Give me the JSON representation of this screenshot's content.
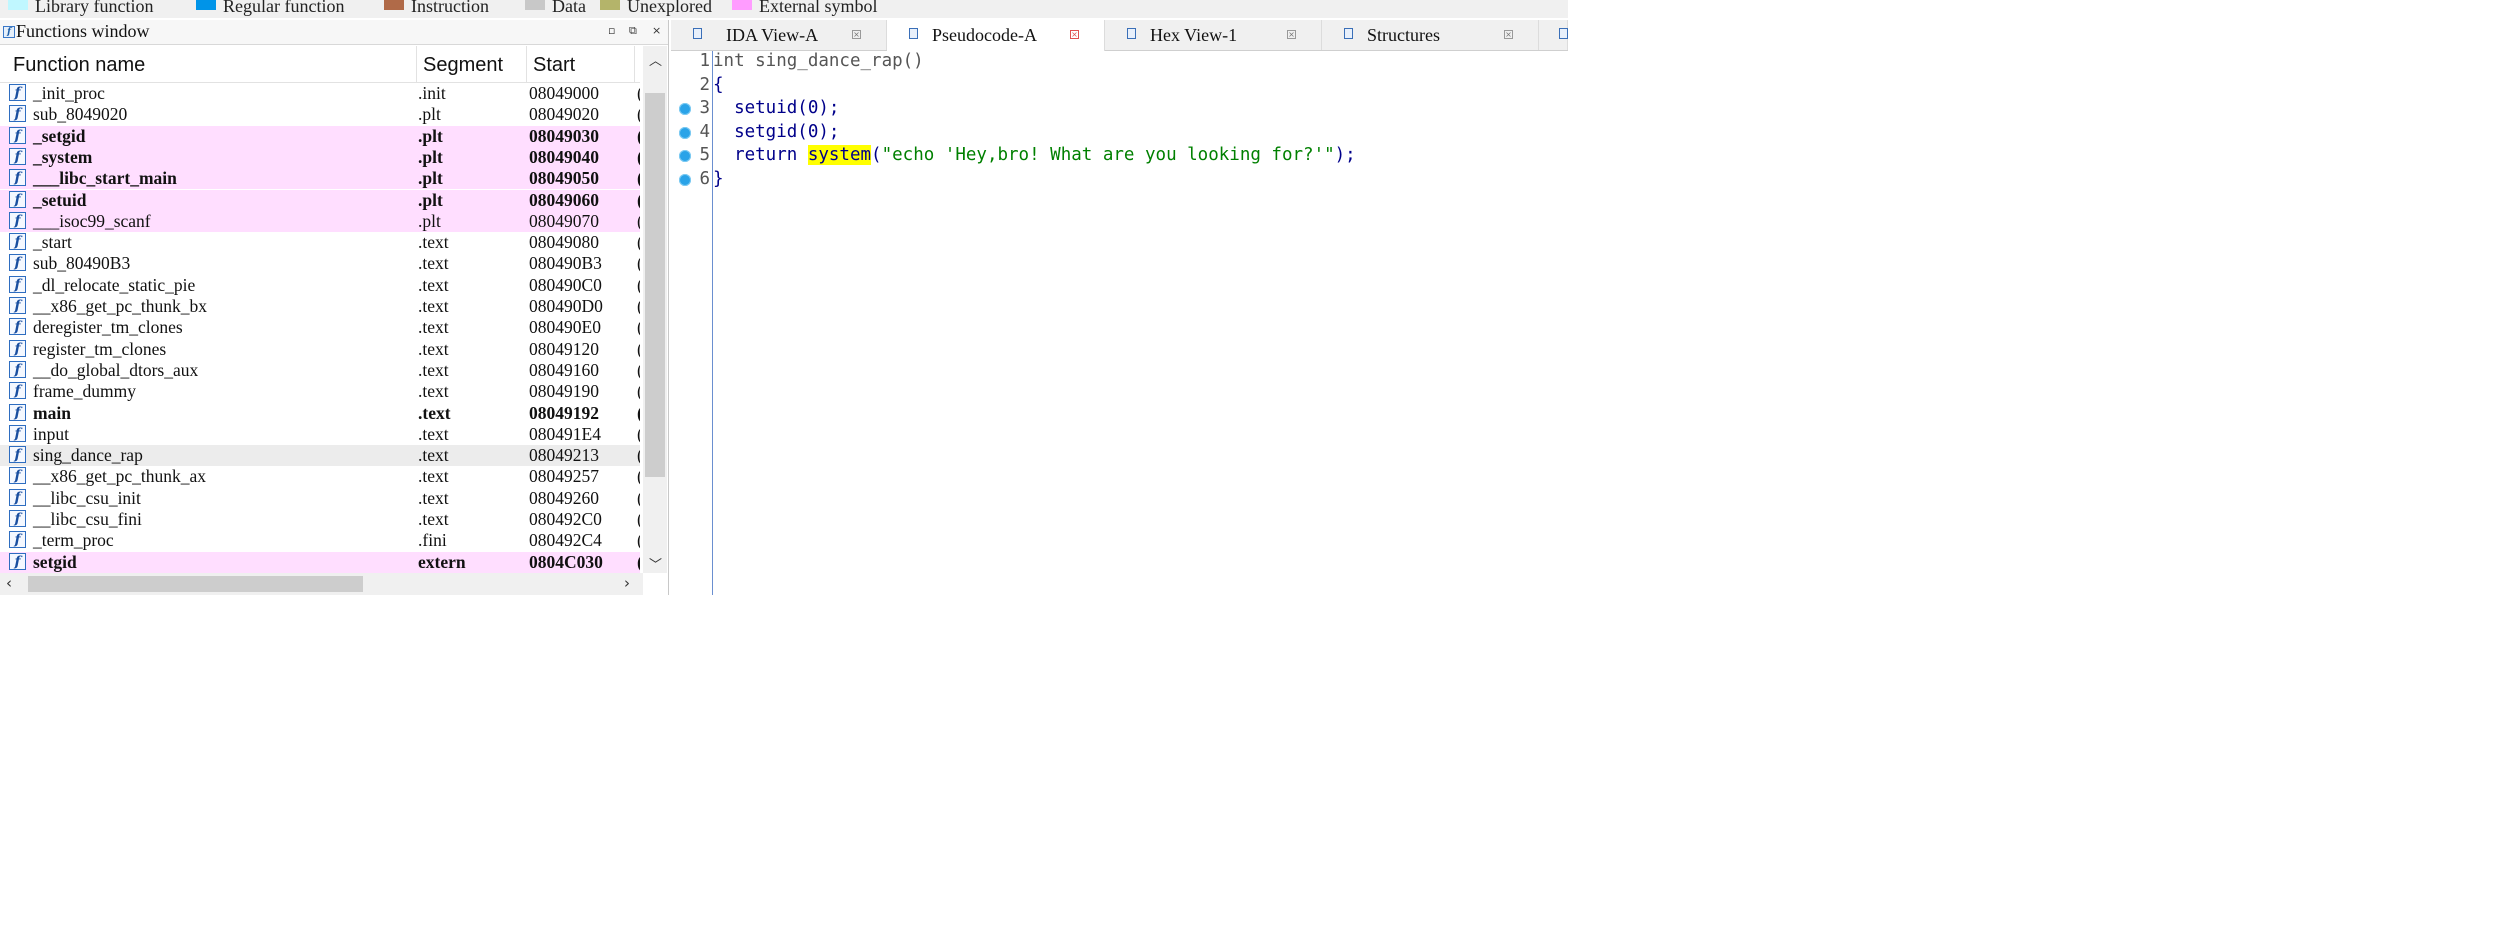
{
  "legend": {
    "items": [
      {
        "label": "Library function",
        "color": "#c0f7ff"
      },
      {
        "label": "Regular function",
        "color": "#0094e8"
      },
      {
        "label": "Instruction",
        "color": "#b06a48"
      },
      {
        "label": "Data",
        "color": "#c8c8c8"
      },
      {
        "label": "Unexplored",
        "color": "#b4b46a"
      },
      {
        "label": "External symbol",
        "color": "#ff9cff"
      }
    ]
  },
  "functions_window": {
    "title": "Functions window",
    "buttons": {
      "minimize": "▫",
      "float": "⧉",
      "close": "×"
    },
    "columns": {
      "name": "Function name",
      "segment": "Segment",
      "start": "Start",
      "length": "("
    },
    "rows": [
      {
        "name": "_init_proc",
        "segment": ".init",
        "start": "08049000",
        "length": "(",
        "kind": "normal"
      },
      {
        "name": "sub_8049020",
        "segment": ".plt",
        "start": "08049020",
        "length": "(",
        "kind": "normal"
      },
      {
        "name": "_setgid",
        "segment": ".plt",
        "start": "08049030",
        "length": "(",
        "kind": "ext-bold"
      },
      {
        "name": "_system",
        "segment": ".plt",
        "start": "08049040",
        "length": "(",
        "kind": "ext-bold"
      },
      {
        "name": "___libc_start_main",
        "segment": ".plt",
        "start": "08049050",
        "length": "(",
        "kind": "ext-bold"
      },
      {
        "name": "_setuid",
        "segment": ".plt",
        "start": "08049060",
        "length": "(",
        "kind": "ext-bold"
      },
      {
        "name": "___isoc99_scanf",
        "segment": ".plt",
        "start": "08049070",
        "length": "(",
        "kind": "ext"
      },
      {
        "name": "_start",
        "segment": ".text",
        "start": "08049080",
        "length": "(",
        "kind": "normal"
      },
      {
        "name": "sub_80490B3",
        "segment": ".text",
        "start": "080490B3",
        "length": "(",
        "kind": "normal"
      },
      {
        "name": "_dl_relocate_static_pie",
        "segment": ".text",
        "start": "080490C0",
        "length": "(",
        "kind": "normal"
      },
      {
        "name": "__x86_get_pc_thunk_bx",
        "segment": ".text",
        "start": "080490D0",
        "length": "(",
        "kind": "normal"
      },
      {
        "name": "deregister_tm_clones",
        "segment": ".text",
        "start": "080490E0",
        "length": "(",
        "kind": "normal"
      },
      {
        "name": "register_tm_clones",
        "segment": ".text",
        "start": "08049120",
        "length": "(",
        "kind": "normal"
      },
      {
        "name": "__do_global_dtors_aux",
        "segment": ".text",
        "start": "08049160",
        "length": "(",
        "kind": "normal"
      },
      {
        "name": "frame_dummy",
        "segment": ".text",
        "start": "08049190",
        "length": "(",
        "kind": "normal"
      },
      {
        "name": "main",
        "segment": ".text",
        "start": "08049192",
        "length": "(",
        "kind": "bold"
      },
      {
        "name": "input",
        "segment": ".text",
        "start": "080491E4",
        "length": "(",
        "kind": "normal"
      },
      {
        "name": "sing_dance_rap",
        "segment": ".text",
        "start": "08049213",
        "length": "(",
        "kind": "selected"
      },
      {
        "name": "__x86_get_pc_thunk_ax",
        "segment": ".text",
        "start": "08049257",
        "length": "(",
        "kind": "normal"
      },
      {
        "name": "__libc_csu_init",
        "segment": ".text",
        "start": "08049260",
        "length": "(",
        "kind": "normal"
      },
      {
        "name": "__libc_csu_fini",
        "segment": ".text",
        "start": "080492C0",
        "length": "(",
        "kind": "normal"
      },
      {
        "name": "_term_proc",
        "segment": ".fini",
        "start": "080492C4",
        "length": "(",
        "kind": "normal"
      },
      {
        "name": "setgid",
        "segment": "extern",
        "start": "0804C030",
        "length": "(",
        "kind": "ext-bold"
      }
    ]
  },
  "tabs": [
    {
      "label": "IDA View-A",
      "active": false
    },
    {
      "label": "Pseudocode-A",
      "active": true
    },
    {
      "label": "Hex View-1",
      "active": false
    },
    {
      "label": "Structures",
      "active": false
    }
  ],
  "code": {
    "lines": [
      {
        "no": "1",
        "parts": [
          {
            "t": "int sing_dance_rap()",
            "c": "fn-name"
          }
        ],
        "bp": false
      },
      {
        "no": "2",
        "parts": [
          {
            "t": "{",
            "c": "brace"
          }
        ],
        "bp": false
      },
      {
        "no": "3",
        "parts": [
          {
            "t": "  setuid(0);",
            "c": "kw"
          }
        ],
        "bp": true
      },
      {
        "no": "4",
        "parts": [
          {
            "t": "  setgid(0);",
            "c": "kw"
          }
        ],
        "bp": true
      },
      {
        "no": "5",
        "parts": [
          {
            "t": "  return ",
            "c": "kw"
          },
          {
            "t": "system",
            "c": "kw hl"
          },
          {
            "t": "(",
            "c": "kw"
          },
          {
            "t": "\"echo 'Hey,bro! What are you looking for?'\"",
            "c": "str"
          },
          {
            "t": ");",
            "c": "kw"
          }
        ],
        "bp": true
      },
      {
        "no": "6",
        "parts": [
          {
            "t": "}",
            "c": "brace"
          }
        ],
        "bp": true
      }
    ]
  }
}
